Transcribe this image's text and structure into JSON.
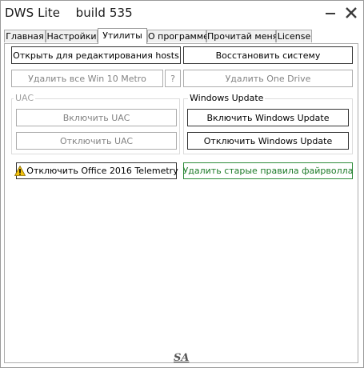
{
  "window": {
    "title": "DWS Lite    build 535",
    "minimize_icon": "minimize-icon",
    "close_icon": "close-icon"
  },
  "tabs": [
    {
      "label": "Главная"
    },
    {
      "label": "Настройки"
    },
    {
      "label": "Утилиты",
      "active": true
    },
    {
      "label": "О программе"
    },
    {
      "label": "Прочитай меня"
    },
    {
      "label": "License"
    }
  ],
  "utilities": {
    "open_hosts": "Открыть для редактирования hosts",
    "restore_system": "Восстановить систему",
    "remove_metro": "Удалить все Win 10 Metro",
    "help": "?",
    "remove_onedrive": "Удалить One Drive",
    "uac": {
      "label": "UAC",
      "enable": "Включить UAC",
      "disable": "Отключить UAC"
    },
    "windows_update": {
      "label": "Windows Update",
      "enable": "Включить Windows Update",
      "disable": "Отключить Windows Update"
    },
    "office_telemetry": "Отключить Office 2016 Telemetry",
    "firewall_rules": "Удалить старые правила файрволла"
  },
  "footer": {
    "logo": "SA"
  },
  "colors": {
    "border_dark": "#333333",
    "disabled_text": "#838383",
    "green_accent": "#1c7a28",
    "warning_yellow": "#f4c20d"
  }
}
